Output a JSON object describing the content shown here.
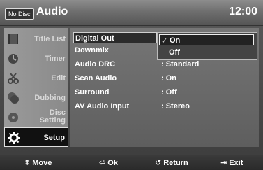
{
  "header": {
    "disc_status": "No Disc",
    "title": "Audio",
    "clock": "12:00"
  },
  "sidebar": {
    "items": [
      {
        "label": "Title List",
        "icon": "film-icon"
      },
      {
        "label": "Timer",
        "icon": "timer-icon"
      },
      {
        "label": "Edit",
        "icon": "scissors-icon"
      },
      {
        "label": "Dubbing",
        "icon": "dubbing-icon"
      },
      {
        "label_line1": "Disc",
        "label_line2": "Setting",
        "icon": "disc-icon"
      },
      {
        "label": "Setup",
        "icon": "gear-icon"
      }
    ],
    "active": "Setup"
  },
  "settings": [
    {
      "name": "Digital Out",
      "value": ""
    },
    {
      "name": "Downmix",
      "value": ""
    },
    {
      "name": "Audio DRC",
      "value": ": Standard"
    },
    {
      "name": "Scan Audio",
      "value": ": On"
    },
    {
      "name": "Surround",
      "value": ": Off"
    },
    {
      "name": "AV Audio Input",
      "value": ": Stereo"
    }
  ],
  "dropdown": {
    "options": [
      {
        "label": "On",
        "check": "✓"
      },
      {
        "label": "Off",
        "check": ""
      }
    ],
    "selected": "On"
  },
  "footer": {
    "move": {
      "icon": "⇕",
      "label": "Move"
    },
    "ok": {
      "icon": "⏎",
      "label": "Ok"
    },
    "return": {
      "icon": "↺",
      "label": "Return"
    },
    "exit": {
      "icon": "⇥",
      "label": "Exit"
    }
  },
  "colors": {
    "header_gradient_top": "#8d8d8d",
    "panel": "#6a6a6a",
    "highlight_border": "#d0d0d0"
  }
}
